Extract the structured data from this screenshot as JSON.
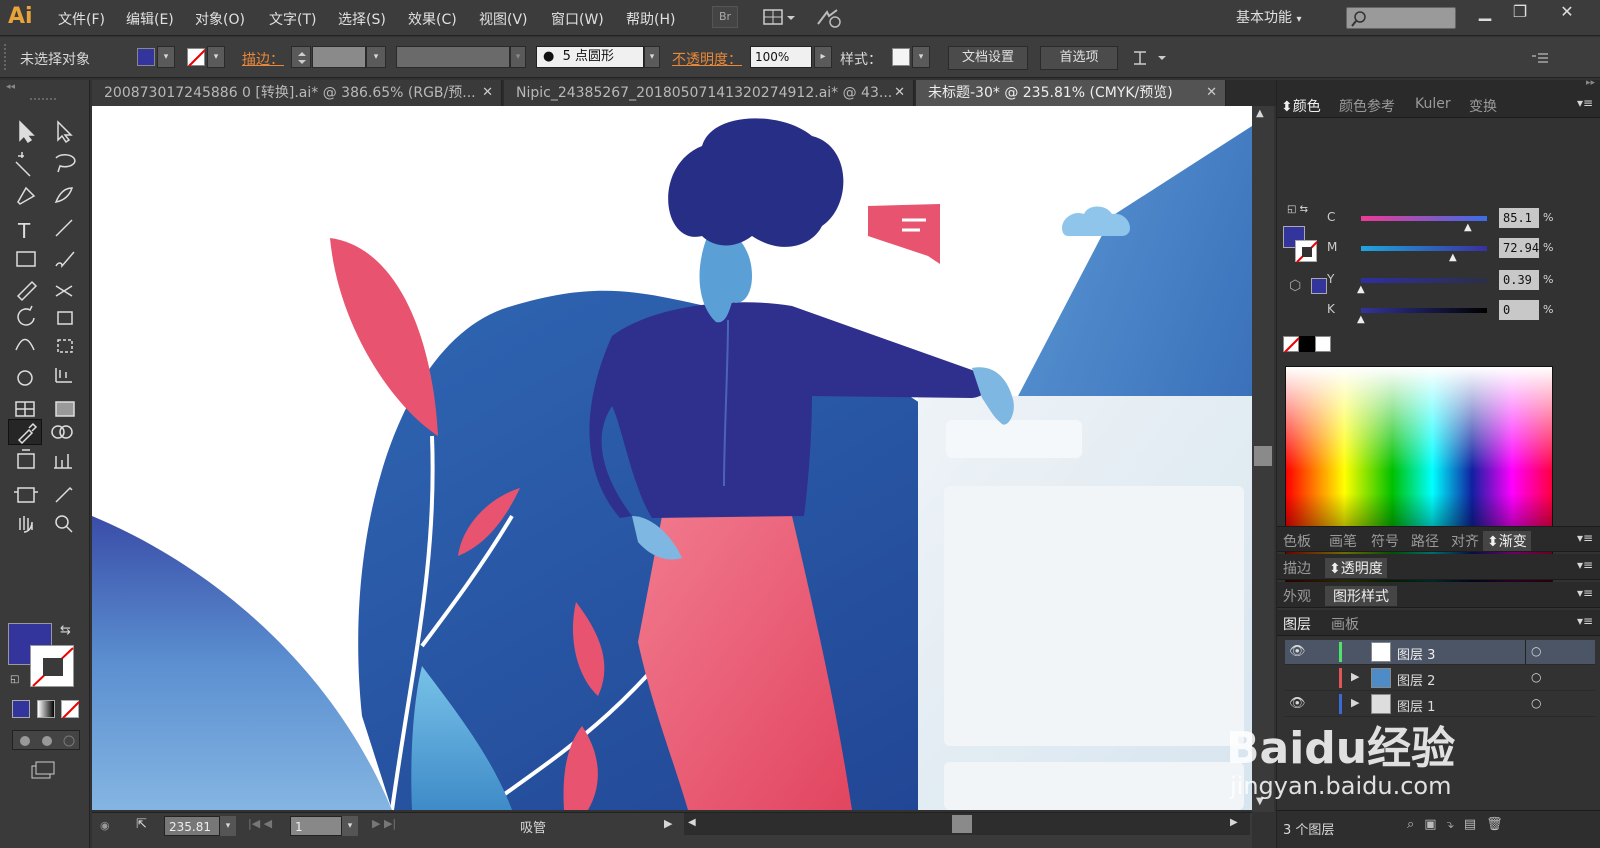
{
  "app": {
    "logo": "Ai"
  },
  "menu": [
    "文件(F)",
    "编辑(E)",
    "对象(O)",
    "文字(T)",
    "选择(S)",
    "效果(C)",
    "视图(V)",
    "窗口(W)",
    "帮助(H)"
  ],
  "menubar": {
    "br_label": "Br",
    "workspace": "基本功能"
  },
  "control": {
    "selection_status": "未选择对象",
    "stroke_label": "描边：",
    "brush_size": "5",
    "brush_shape": "点圆形",
    "opacity_label": "不透明度：",
    "opacity_value": "100%",
    "style_label": "样式：",
    "doc_setup": "文档设置",
    "preferences": "首选项"
  },
  "tabs": [
    {
      "label": "200873017245886 0 [转换].ai* @ 386.65% (RGB/预..."
    },
    {
      "label": "Nipic_24385267_20180507141320274912.ai* @ 43..."
    },
    {
      "label": "未标题-30* @ 235.81% (CMYK/预览)"
    }
  ],
  "colors": {
    "fill": "#33349c",
    "accent_orange": "#e8883a"
  },
  "color_panel": {
    "tabs": [
      "颜色",
      "颜色参考",
      "Kuler",
      "变换"
    ],
    "channels": [
      {
        "label": "C",
        "value": "85.1",
        "level": 0.851
      },
      {
        "label": "M",
        "value": "72.94",
        "level": 0.7294
      },
      {
        "label": "Y",
        "value": "0.39",
        "level": 0.0039
      },
      {
        "label": "K",
        "value": "0",
        "level": 0
      }
    ],
    "unit": "%"
  },
  "panel_rows": {
    "row1": [
      "色板",
      "画笔",
      "符号",
      "路径",
      "对齐",
      "渐变"
    ],
    "row2": [
      "描边",
      "透明度"
    ],
    "row3": [
      "外观",
      "图形样式"
    ],
    "row4": [
      "图层",
      "画板"
    ]
  },
  "layers": [
    {
      "name": "图层 3"
    },
    {
      "name": "图层 2"
    },
    {
      "name": "图层 1"
    }
  ],
  "layers_count": "3 个图层",
  "status": {
    "zoom": "235.81",
    "page": "1",
    "tool": "吸管"
  },
  "watermark": {
    "brand": "Baidu经验",
    "url": "jingyan.baidu.com"
  }
}
